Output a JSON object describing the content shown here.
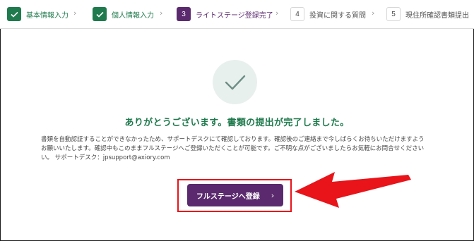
{
  "stepper": {
    "steps": [
      {
        "number": "✓",
        "label": "基本情報入力",
        "state": "done"
      },
      {
        "number": "✓",
        "label": "個人情報入力",
        "state": "done"
      },
      {
        "number": "3",
        "label": "ライトステージ登録完了",
        "state": "current"
      },
      {
        "number": "4",
        "label": "投資に関する質問",
        "state": "pending"
      },
      {
        "number": "5",
        "label": "現住所確認書類提出",
        "state": "pending"
      }
    ],
    "separator": "›"
  },
  "main": {
    "heading": "ありがとうございます。書類の提出が完了しました。",
    "body_lines": [
      "書類を自動認証することができなかったため、サポートデスクにて確認しております。確認後のご連絡まで今しばらくお待ちいただけますよう",
      "お願いいたします。確認中もこのままフルステージへご登録いただくことが可能です。ご不明な点がございましたらお気軽にお問合せください",
      "い。 サポートデスク：jpsupport@axiory.com"
    ],
    "cta_label": "フルステージへ登録",
    "cta_arrow": "›"
  },
  "colors": {
    "done_green": "#1f7a4d",
    "current_purple": "#5b2a6e",
    "annotation_red": "#e8141a",
    "check_circle_bg": "#e8f0ee"
  },
  "icons": {
    "step_done": "check-icon",
    "success": "check-icon",
    "cta": "chevron-right-icon",
    "annotation": "arrow-pointer-icon"
  }
}
